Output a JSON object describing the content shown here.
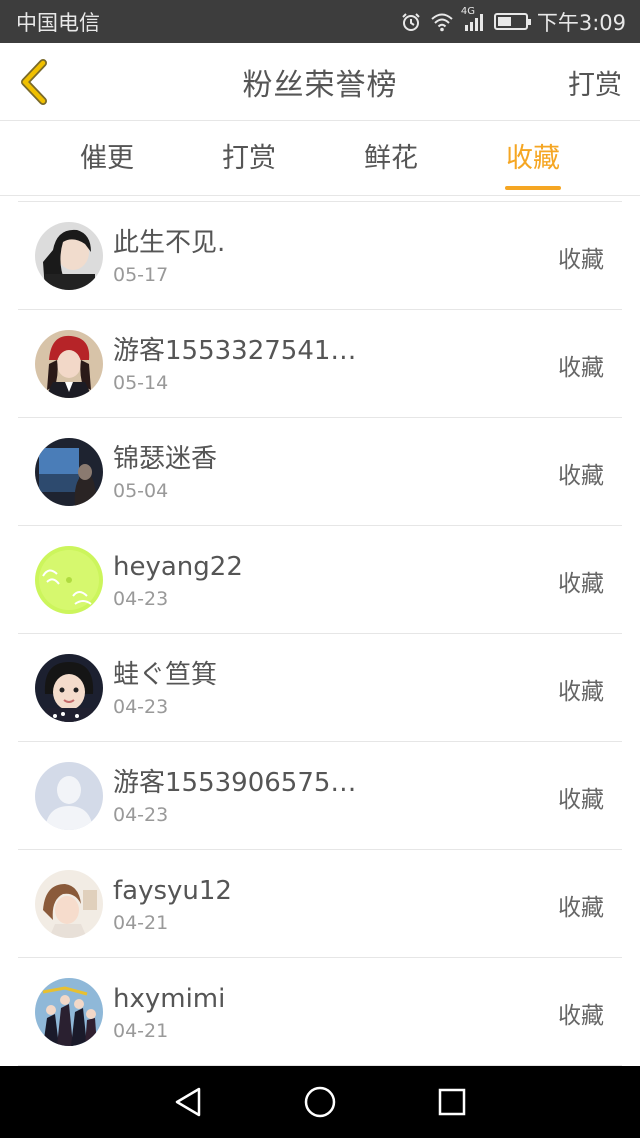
{
  "status_bar": {
    "carrier": "中国电信",
    "network": "4G",
    "time": "下午3:09",
    "battery_level": 0.5
  },
  "header": {
    "title": "粉丝荣誉榜",
    "action_label": "打赏"
  },
  "tabs": [
    {
      "label": "催更",
      "active": false
    },
    {
      "label": "打赏",
      "active": false
    },
    {
      "label": "鲜花",
      "active": false
    },
    {
      "label": "收藏",
      "active": true
    }
  ],
  "list": [
    {
      "name": "此生不见.",
      "date": "05-17",
      "action": "收藏",
      "avatar_color": "#3a3a3a"
    },
    {
      "name": "游客1553327541…",
      "date": "05-14",
      "action": "收藏",
      "avatar_color": "#b0383a"
    },
    {
      "name": "锦瑟迷香",
      "date": "05-04",
      "action": "收藏",
      "avatar_color": "#2d3a4f"
    },
    {
      "name": "heyang22",
      "date": "04-23",
      "action": "收藏",
      "avatar_color": "#c8f05a"
    },
    {
      "name": "蛙ぐ笪箕",
      "date": "04-23",
      "action": "收藏",
      "avatar_color": "#2a2a3a"
    },
    {
      "name": "游客1553906575…",
      "date": "04-23",
      "action": "收藏",
      "avatar_color": "#d5dce8"
    },
    {
      "name": "faysyu12",
      "date": "04-21",
      "action": "收藏",
      "avatar_color": "#e8d6c4"
    },
    {
      "name": "hxymimi",
      "date": "04-21",
      "action": "收藏",
      "avatar_color": "#5a7fa8"
    }
  ],
  "colors": {
    "accent": "#f5a623",
    "back_arrow": "#e8b400",
    "status_bar_bg": "#3d3d3d",
    "nav_bar_bg": "#000000"
  },
  "icons": {
    "back": "back-arrow-icon",
    "alarm": "alarm-icon",
    "wifi": "wifi-icon",
    "signal": "signal-icon",
    "battery": "battery-icon",
    "nav_back": "triangle-back-icon",
    "nav_home": "circle-home-icon",
    "nav_recent": "square-recent-icon"
  }
}
